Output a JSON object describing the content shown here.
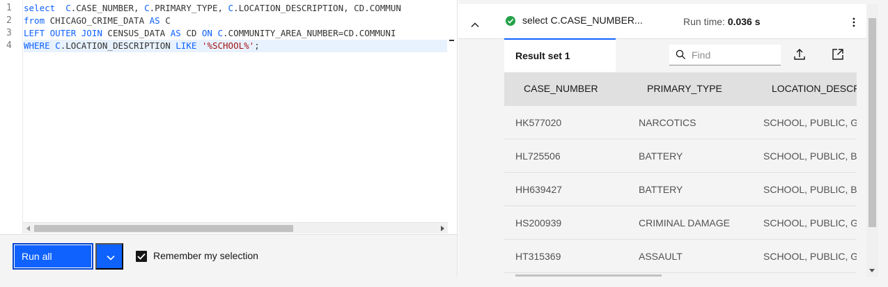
{
  "editor": {
    "line_numbers": [
      "1",
      "2",
      "3",
      "4"
    ],
    "lines": [
      {
        "segments": [
          [
            "kw",
            "select"
          ],
          [
            "",
            "  "
          ],
          [
            "kw2",
            "C"
          ],
          [
            "",
            ".CASE_NUMBER, "
          ],
          [
            "kw2",
            "C"
          ],
          [
            "",
            ".PRIMARY_TYPE, "
          ],
          [
            "kw2",
            "C"
          ],
          [
            "",
            ".LOCATION_DESCRIPTION, CD.COMMUN"
          ]
        ]
      },
      {
        "segments": [
          [
            "kw",
            "from"
          ],
          [
            "",
            " CHICAGO_CRIME_DATA "
          ],
          [
            "kw",
            "AS"
          ],
          [
            "",
            " C"
          ]
        ]
      },
      {
        "segments": [
          [
            "kw",
            "LEFT OUTER JOIN"
          ],
          [
            "",
            " CENSUS_DATA "
          ],
          [
            "kw",
            "AS"
          ],
          [
            "",
            " CD "
          ],
          [
            "kw",
            "ON"
          ],
          [
            "",
            " "
          ],
          [
            "kw2",
            "C"
          ],
          [
            "",
            ".COMMUNITY_AREA_NUMBER=CD.COMMUNI"
          ]
        ]
      },
      {
        "segments": [
          [
            "kw",
            "WHERE"
          ],
          [
            "",
            " "
          ],
          [
            "kw2",
            "C"
          ],
          [
            "",
            ".LOCATION_DESCRIPTION "
          ],
          [
            "kw",
            "LIKE"
          ],
          [
            "",
            " "
          ],
          [
            "str",
            "'%SCHOOL%'"
          ],
          [
            "",
            ";"
          ]
        ]
      }
    ]
  },
  "toolbar": {
    "run_all_label": "Run all",
    "remember_label": "Remember my selection",
    "remember_checked": true
  },
  "result": {
    "query_title": "select C.CASE_NUMBER...",
    "runtime_label": "Run time: ",
    "runtime_value": "0.036 s",
    "tab_label": "Result set 1",
    "find_placeholder": "Find",
    "columns": [
      "CASE_NUMBER",
      "PRIMARY_TYPE",
      "LOCATION_DESCR"
    ],
    "rows": [
      [
        "HK577020",
        "NARCOTICS",
        "SCHOOL, PUBLIC, GF"
      ],
      [
        "HL725506",
        "BATTERY",
        "SCHOOL, PUBLIC, BU"
      ],
      [
        "HH639427",
        "BATTERY",
        "SCHOOL, PUBLIC, BU"
      ],
      [
        "HS200939",
        "CRIMINAL DAMAGE",
        "SCHOOL, PUBLIC, GF"
      ],
      [
        "HT315369",
        "ASSAULT",
        "SCHOOL, PUBLIC, GF"
      ]
    ]
  },
  "icons": {
    "collapse": "chevron-up-icon",
    "success": "checkmark-filled-icon",
    "overflow": "overflow-menu-vertical-icon",
    "find": "search-icon",
    "export": "export-upload-icon",
    "launch": "launch-new-window-icon",
    "dropdown": "chevron-down-icon",
    "checkbox": "checkbox-checked-icon"
  },
  "colors": {
    "primary": "#0f62fe",
    "success": "#24a148",
    "header_bg": "#e0e0e0",
    "row_bg": "#f4f4f4"
  }
}
